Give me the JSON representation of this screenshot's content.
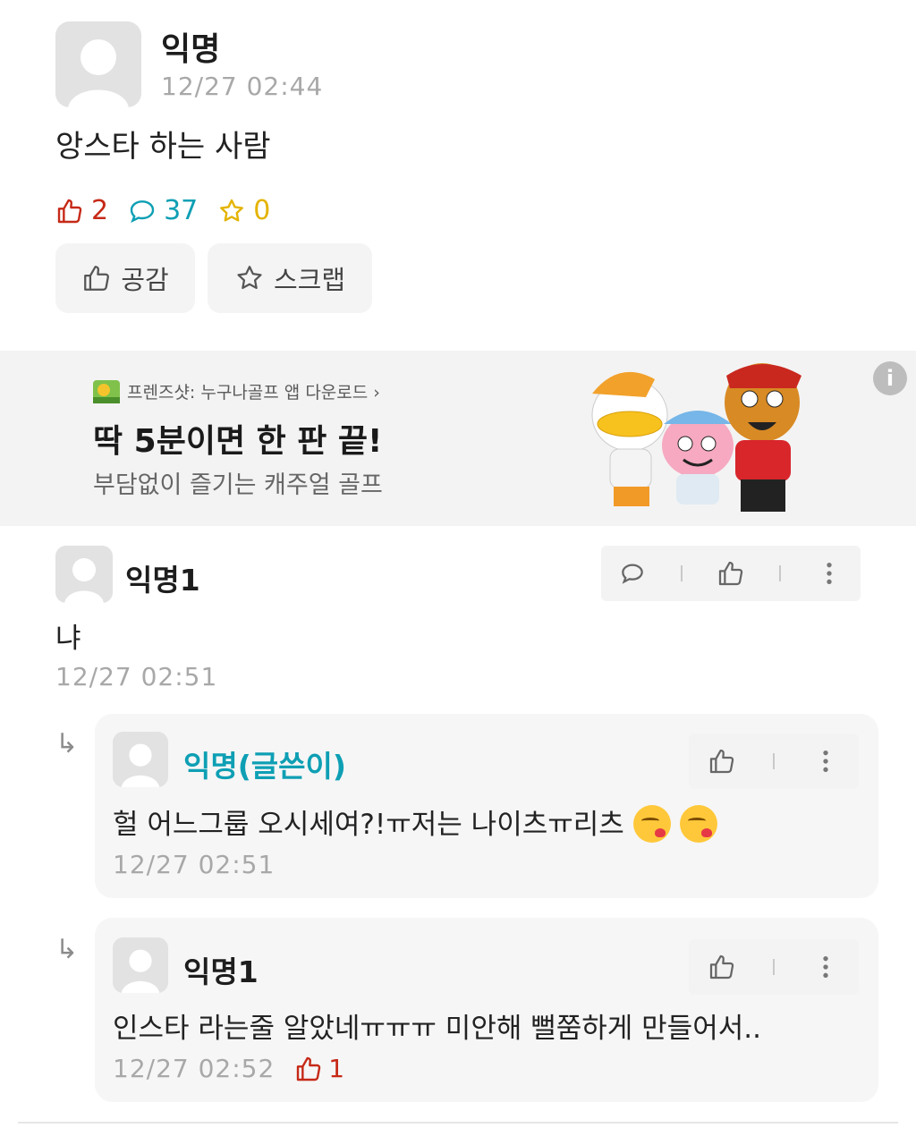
{
  "post": {
    "author": "익명",
    "time": "12/27 02:44",
    "body": "앙스타 하는 사람",
    "likes": "2",
    "comments": "37",
    "scraps": "0",
    "empathy_label": "공감",
    "scrap_label": "스크랩"
  },
  "ad": {
    "source": "프렌즈샷: 누구나골프 앱 다운로드 ›",
    "headline": "딱 5분이면 한 판 끝!",
    "sub": "부담없이 즐기는 캐주얼 골프",
    "info_glyph": "i"
  },
  "comments": [
    {
      "author": "익명1",
      "body": "냐",
      "time": "12/27 02:51"
    }
  ],
  "replies": [
    {
      "author": "익명(글쓴이)",
      "body": "헐 어느그룹 오시세여?!ㅠ저는 나이츠ㅠ리츠",
      "time": "12/27 02:51"
    },
    {
      "author": "익명1",
      "body": "인스타 라는줄 알았네ㅠㅠㅠ 미안해 뻘쭘하게 만들어서..",
      "time": "12/27 02:52",
      "likes": "1"
    }
  ],
  "reply_arrow": "↳",
  "colors": {
    "like": "#c62917",
    "comment": "#0e9fb4",
    "scrap": "#e4b300",
    "op_name": "#0e9fb4"
  }
}
